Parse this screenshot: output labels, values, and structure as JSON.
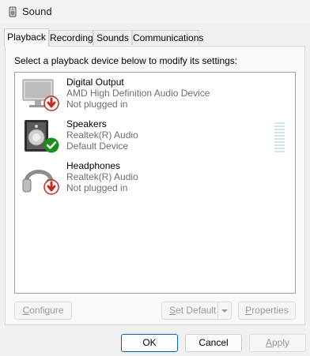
{
  "window": {
    "title": "Sound",
    "app_icon": "speaker-icon"
  },
  "tabs": [
    {
      "label": "Playback",
      "active": true
    },
    {
      "label": "Recording",
      "active": false
    },
    {
      "label": "Sounds",
      "active": false
    },
    {
      "label": "Communications",
      "active": false
    }
  ],
  "instruction": "Select a playback device below to modify its settings:",
  "devices": [
    {
      "name": "Digital Output",
      "driver": "AMD High Definition Audio Device",
      "status": "Not plugged in",
      "icon": "monitor-icon",
      "badge": "red-down-arrow-badge"
    },
    {
      "name": "Speakers",
      "driver": "Realtek(R) Audio",
      "status": "Default Device",
      "icon": "speaker-icon",
      "badge": "green-check-badge"
    },
    {
      "name": "Headphones",
      "driver": "Realtek(R) Audio",
      "status": "Not plugged in",
      "icon": "headphones-icon",
      "badge": "red-down-arrow-badge"
    }
  ],
  "buttons": {
    "configure_first": "C",
    "configure_rest": "onfigure",
    "set_default_first": "S",
    "set_default_rest": "et Default",
    "properties_first": "P",
    "properties_rest": "roperties",
    "ok": "OK",
    "cancel": "Cancel",
    "apply_first": "A",
    "apply_rest": "pply"
  },
  "colors": {
    "accent": "#0067c0",
    "success": "#1a8f1a",
    "error": "#c42b1c"
  }
}
